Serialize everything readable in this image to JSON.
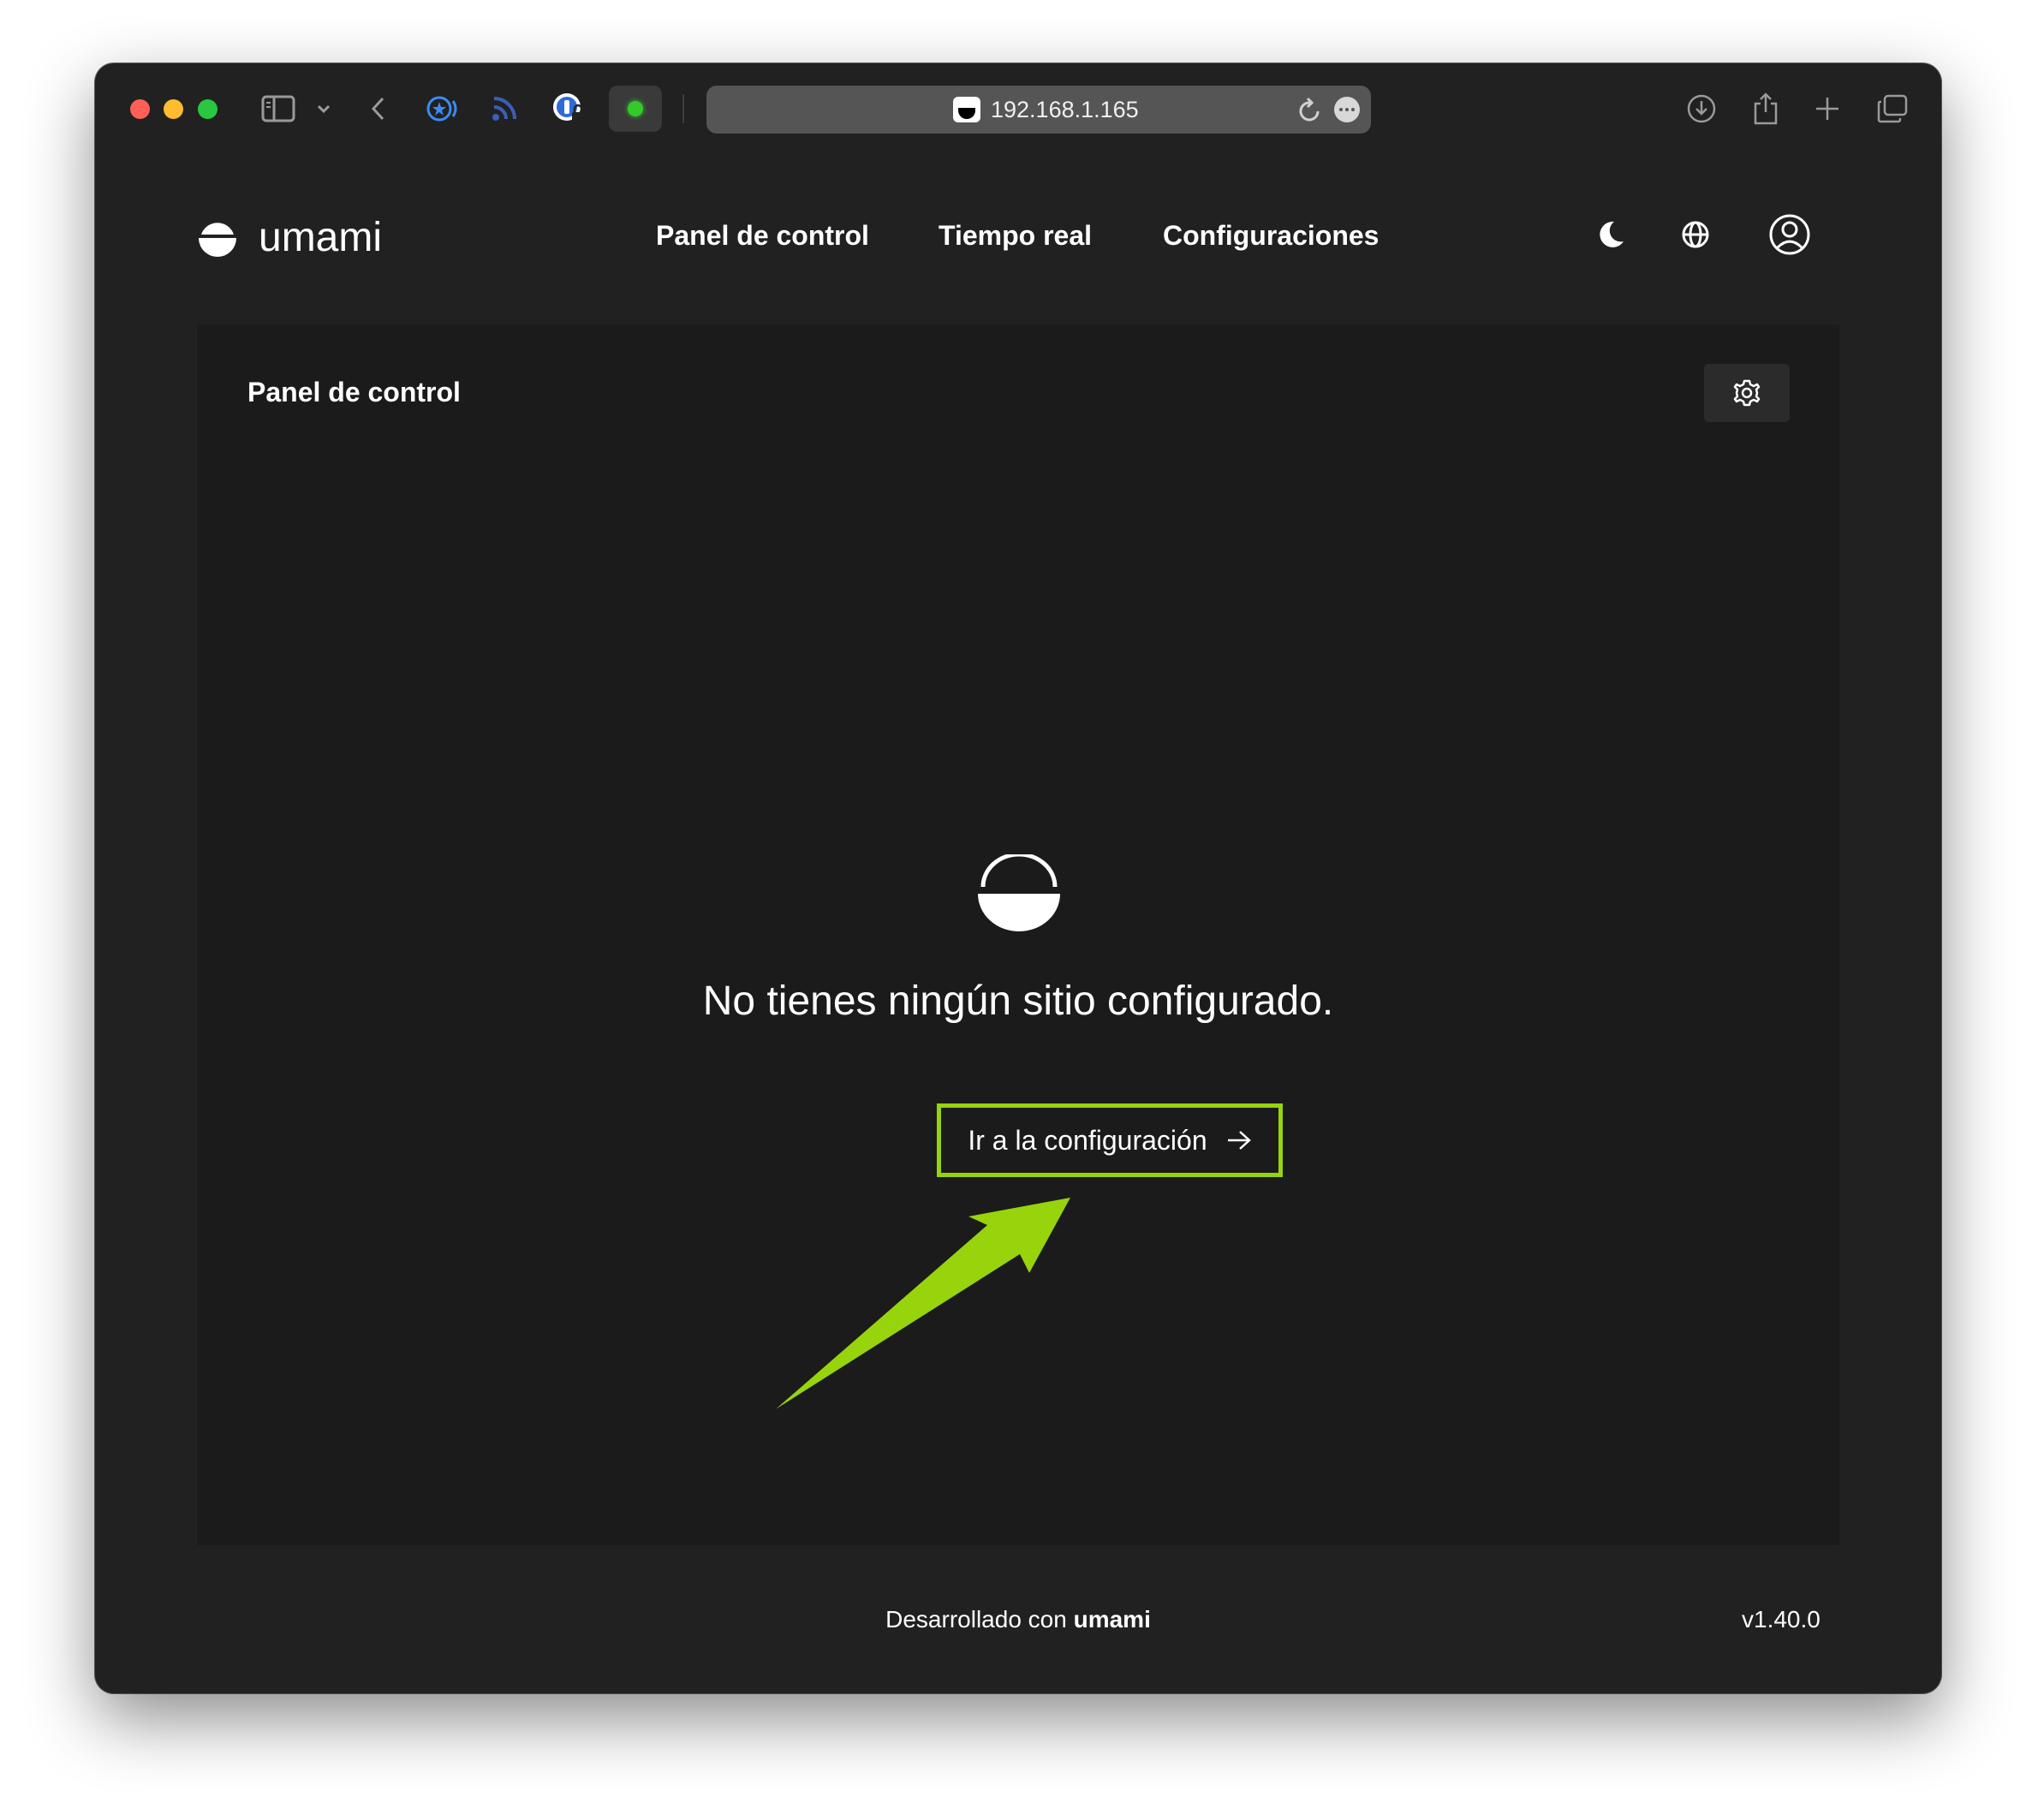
{
  "browser": {
    "url": "192.168.1.165",
    "icons": [
      "sidebar-icon",
      "chevron-down-icon",
      "back-icon",
      "extension-icon",
      "rss-icon",
      "password-extension-icon",
      "status-dot-icon",
      "reload-icon",
      "more-icon",
      "download-icon",
      "share-icon",
      "new-tab-icon",
      "tabs-overview-icon"
    ]
  },
  "header": {
    "brand": "umami",
    "nav": [
      "Panel de control",
      "Tiempo real",
      "Configuraciones"
    ],
    "icons": [
      "moon-icon",
      "globe-icon",
      "user-icon"
    ]
  },
  "panel": {
    "title": "Panel de control",
    "empty_message": "No tienes ningún sitio configurado.",
    "cta_label": "Ir a la configuración"
  },
  "footer": {
    "prefix": "Desarrollado con",
    "brand": "umami",
    "version": "v1.40.0"
  },
  "colors": {
    "highlight": "#97d40c",
    "window_bg": "#212121",
    "panel_bg": "#1b1b1b"
  }
}
